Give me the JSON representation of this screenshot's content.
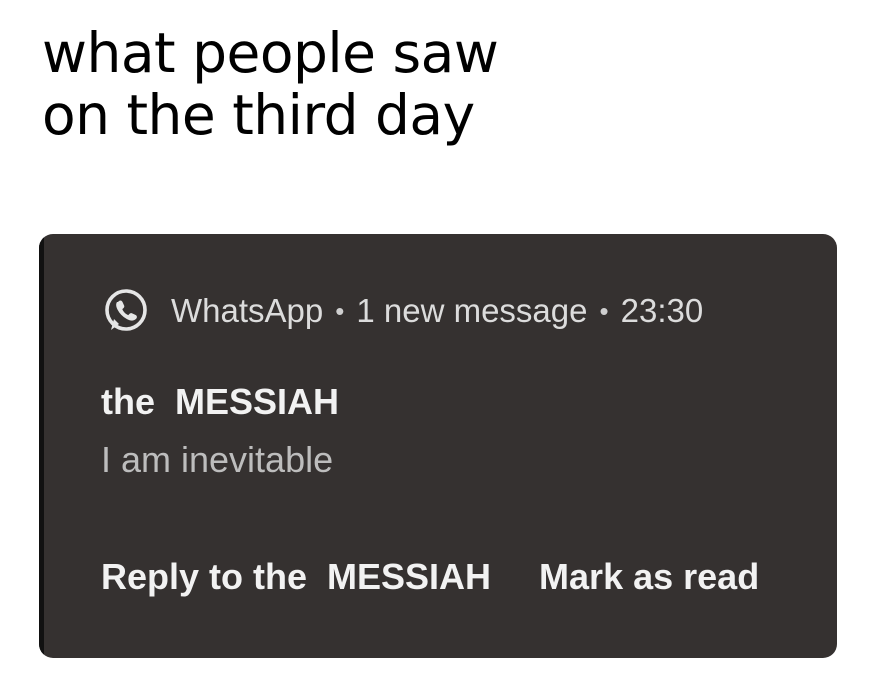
{
  "caption": {
    "line1": "what people saw",
    "line2": "on the third day"
  },
  "notification": {
    "app_icon": "whatsapp-icon",
    "app_name": "WhatsApp",
    "separator": "•",
    "summary": "1 new message",
    "time": "23:30",
    "sender": "the  MESSIAH",
    "message": "I am inevitable",
    "actions": {
      "reply": "Reply to the  MESSIAH",
      "mark_read": "Mark as read"
    },
    "colors": {
      "background": "#353130",
      "primary_text": "#f2f2f2",
      "secondary_text": "#bdbdbd"
    }
  }
}
